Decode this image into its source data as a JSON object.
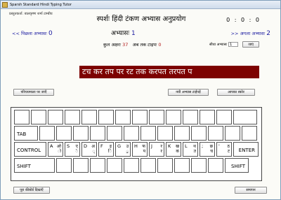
{
  "window": {
    "title": "Sparsh Standard Hindi Typing Tutor"
  },
  "header": {
    "prepared_by": "प्रस्तुतकर्ता: बालकृष्ण शर्मा टाम्बीय",
    "heading": "स्पर्शः हिंदी टंकण अभ्यास अनुप्रयोग",
    "timer": "0 : 0 : 0"
  },
  "lesson_nav": {
    "prev_label": "<< पिछला अभ्यासः",
    "prev_number": "0",
    "current_label": "अभ्यासः",
    "current_number": "1",
    "next_label": ">> अगला अभ्यासः",
    "next_number": "2"
  },
  "stats": {
    "total_label": "कुल अक्षरः",
    "total_value": "37",
    "typed_label": "अब तक टाइपः",
    "typed_value": "0"
  },
  "goto": {
    "label": "सीधा अभ्यासः",
    "value": "1",
    "button": "जाएं"
  },
  "practice_text": "टच कर तप पर रट तक करपत तरपत प",
  "buttons": {
    "select_practice": "परिचयमाला पर जाएँ",
    "new_practice_text": "नयी अभ्यास टाईपड़ें",
    "your_score": "आपका स्कोर",
    "show_keyboard": "पूरा कीबोर्ड दिखाएँ",
    "finish": "समापन"
  },
  "keyboard": {
    "tab": "TAB",
    "control": "CONTROL",
    "enter": "ENTER",
    "shift_left": "SHIFT",
    "shift_right": "SHIFT",
    "home_keys": [
      {
        "letter": "A",
        "shift": "ओ",
        "hindi": "ो"
      },
      {
        "letter": "S",
        "shift": "ए",
        "hindi": "े"
      },
      {
        "letter": "D",
        "shift": "अ",
        "hindi": "्"
      },
      {
        "letter": "F",
        "shift": "इ",
        "hindi": "ि"
      },
      {
        "letter": "G",
        "shift": "उ",
        "hindi": "ु"
      },
      {
        "letter": "H",
        "shift": "फ",
        "hindi": "प"
      },
      {
        "letter": "J",
        "shift": "र",
        "hindi": "र"
      },
      {
        "letter": "K",
        "shift": "ख",
        "hindi": "क"
      },
      {
        "letter": "L",
        "shift": "थ",
        "hindi": "त"
      },
      {
        "letter": ";",
        "shift": "छ",
        "hindi": "च"
      },
      {
        "letter": "'",
        "shift": "ठ",
        "hindi": "ट"
      }
    ]
  },
  "colors": {
    "strip_bg": "#7d0202",
    "link": "#1a1aa0",
    "count": "#b01414"
  }
}
